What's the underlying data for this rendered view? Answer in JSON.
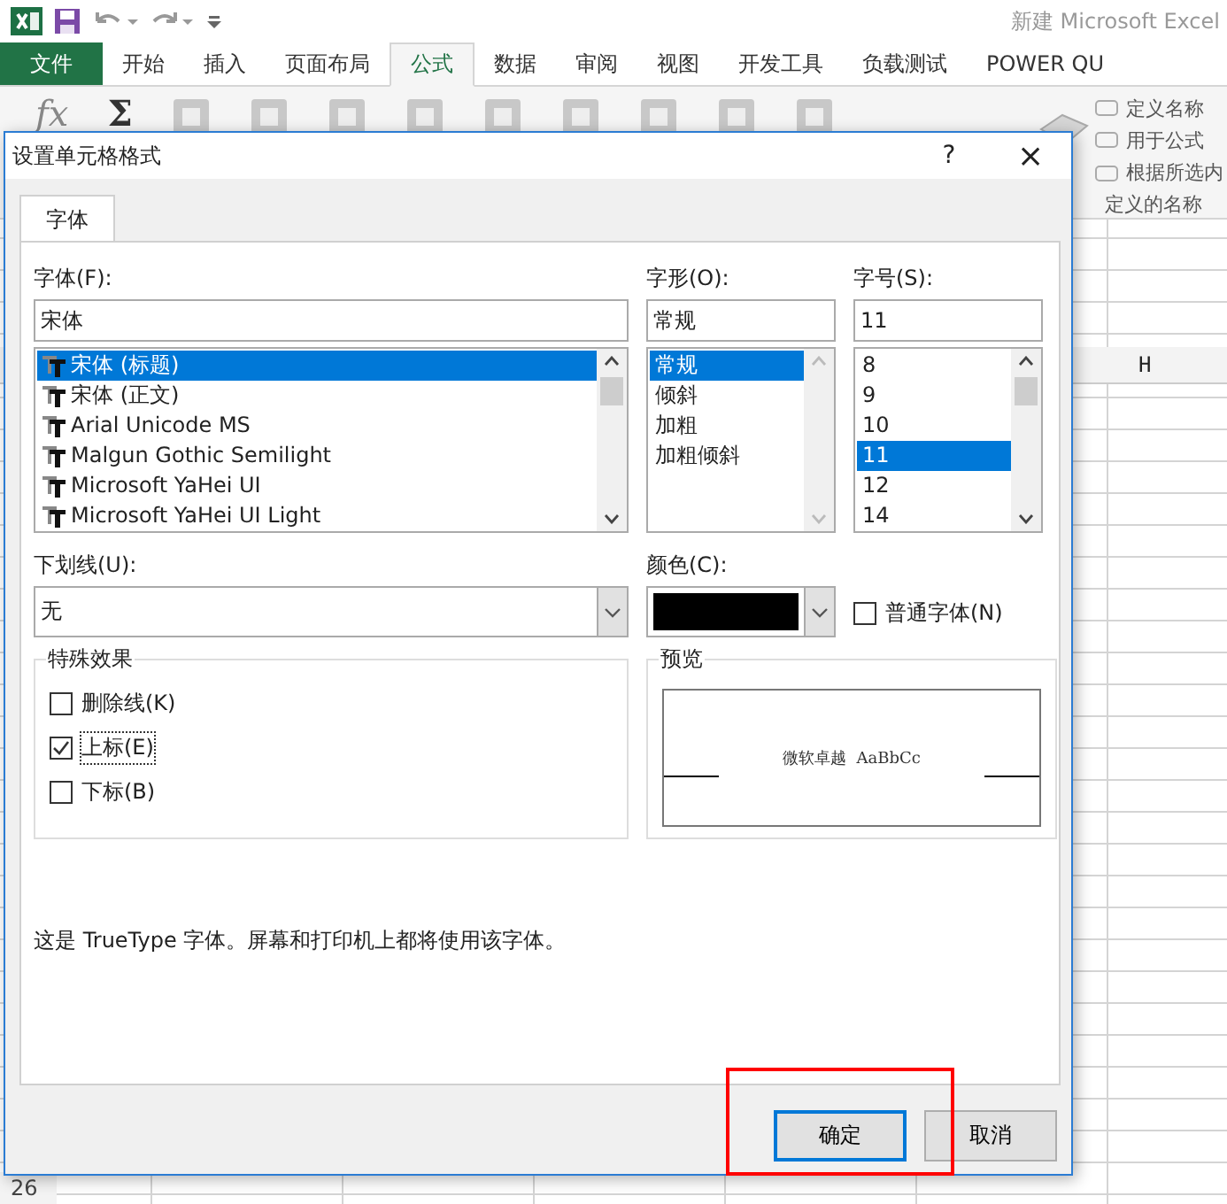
{
  "app": {
    "title": "新建 Microsoft Excel",
    "file_tab": "文件",
    "ribbon_tabs": [
      {
        "label": "开始",
        "selected": false
      },
      {
        "label": "插入",
        "selected": false
      },
      {
        "label": "页面布局",
        "selected": false
      },
      {
        "label": "公式",
        "selected": true
      },
      {
        "label": "数据",
        "selected": false
      },
      {
        "label": "审阅",
        "selected": false
      },
      {
        "label": "视图",
        "selected": false
      },
      {
        "label": "开发工具",
        "selected": false
      },
      {
        "label": "负载测试",
        "selected": false
      },
      {
        "label": "POWER QU",
        "selected": false
      }
    ],
    "ribbon_glyphs": [
      "fx",
      "Σ"
    ],
    "name_commands": [
      {
        "label": "定义名称"
      },
      {
        "label": "用于公式"
      },
      {
        "label": "根据所选内"
      }
    ],
    "group_label": "定义的名称"
  },
  "sheet": {
    "column_header": "H",
    "row_number": "26"
  },
  "dialog": {
    "title": "设置单元格格式",
    "help": "?",
    "close": "×",
    "tabs": [
      {
        "label": "字体",
        "selected": true
      }
    ],
    "font": {
      "label": "字体(F):",
      "value": "宋体",
      "items": [
        {
          "label": "宋体 (标题)",
          "selected": true
        },
        {
          "label": "宋体 (正文)",
          "selected": false
        },
        {
          "label": "Arial Unicode MS",
          "selected": false
        },
        {
          "label": "Malgun Gothic Semilight",
          "selected": false
        },
        {
          "label": "Microsoft YaHei UI",
          "selected": false
        },
        {
          "label": "Microsoft YaHei UI Light",
          "selected": false
        }
      ]
    },
    "style": {
      "label": "字形(O):",
      "value": "常规",
      "items": [
        {
          "label": "常规",
          "selected": true
        },
        {
          "label": "倾斜",
          "selected": false
        },
        {
          "label": "加粗",
          "selected": false
        },
        {
          "label": "加粗倾斜",
          "selected": false
        }
      ]
    },
    "size": {
      "label": "字号(S):",
      "value": "11",
      "items": [
        {
          "label": "8",
          "selected": false
        },
        {
          "label": "9",
          "selected": false
        },
        {
          "label": "10",
          "selected": false
        },
        {
          "label": "11",
          "selected": true
        },
        {
          "label": "12",
          "selected": false
        },
        {
          "label": "14",
          "selected": false
        }
      ]
    },
    "underline": {
      "label": "下划线(U):",
      "value": "无"
    },
    "color": {
      "label": "颜色(C):",
      "color": "#000000"
    },
    "normal_font": {
      "label": "普通字体(N)",
      "checked": false
    },
    "effects": {
      "title": "特殊效果",
      "items": [
        {
          "label": "删除线(K)",
          "checked": false
        },
        {
          "label": "上标(E)",
          "checked": true
        },
        {
          "label": "下标(B)",
          "checked": false
        }
      ]
    },
    "preview": {
      "title": "预览",
      "sample": "微软卓越  AaBbCc"
    },
    "description": "这是 TrueType 字体。屏幕和打印机上都将使用该字体。",
    "buttons": [
      {
        "label": "确定",
        "default": true
      },
      {
        "label": "取消",
        "default": false
      }
    ]
  }
}
